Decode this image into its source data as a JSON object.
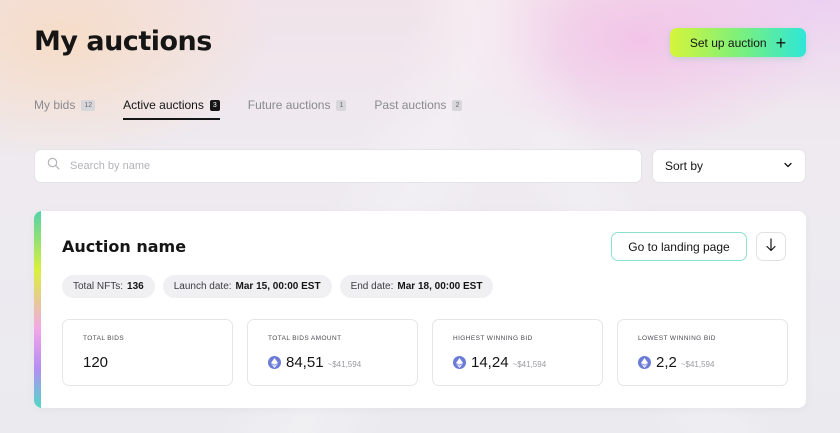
{
  "header": {
    "title": "My auctions",
    "setup_button_label": "Set up auction",
    "setup_button_icon": "plus-icon"
  },
  "tabs": [
    {
      "label": "My bids",
      "count": "12",
      "active": false
    },
    {
      "label": "Active auctions",
      "count": "3",
      "active": true
    },
    {
      "label": "Future auctions",
      "count": "1",
      "active": false
    },
    {
      "label": "Past auctions",
      "count": "2",
      "active": false
    }
  ],
  "search": {
    "placeholder": "Search by name",
    "value": ""
  },
  "sort": {
    "label": "Sort by"
  },
  "auction": {
    "name": "Auction name",
    "landing_button_label": "Go to landing page",
    "chips": [
      {
        "label": "Total NFTs:",
        "value": "136"
      },
      {
        "label": "Launch date:",
        "value": "Mar 15, 00:00 EST"
      },
      {
        "label": "End date:",
        "value": "Mar 18, 00:00 EST"
      }
    ],
    "stats": [
      {
        "label": "TOTAL BIDS",
        "value": "120",
        "usd": ""
      },
      {
        "label": "TOTAL BIDS AMOUNT",
        "value": "84,51",
        "usd": "~$41,594"
      },
      {
        "label": "HIGHEST WINNING BID",
        "value": "14,24",
        "usd": "~$41,594"
      },
      {
        "label": "LOWEST WINNING BID",
        "value": "2,2",
        "usd": "~$41,594"
      }
    ]
  },
  "colors": {
    "accent_gradient": [
      "#d6f53a",
      "#7ef07a",
      "#2ee6d8"
    ],
    "eth_icon": "#6b7bd6"
  }
}
